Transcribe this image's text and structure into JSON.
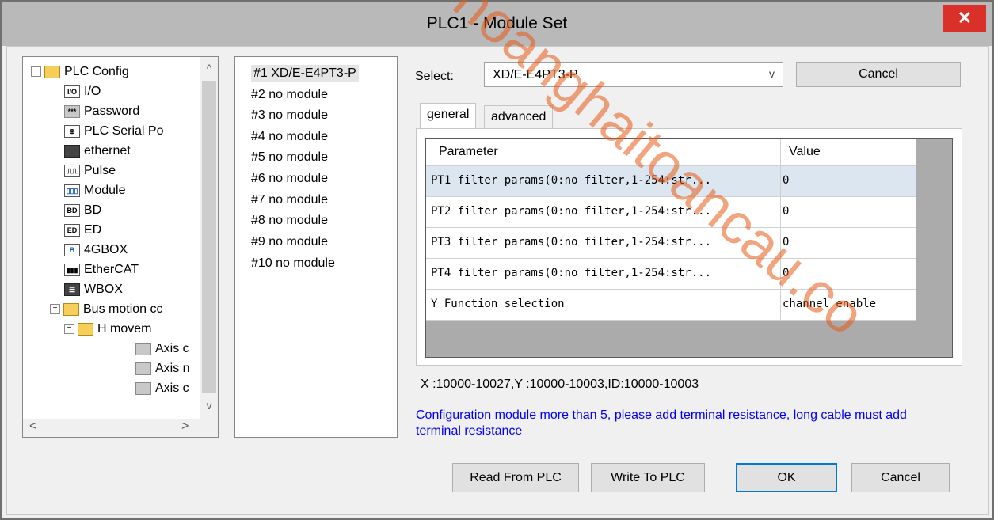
{
  "window": {
    "title": "PLC1 - Module  Set",
    "close_glyph": "✕"
  },
  "tree": {
    "items": [
      {
        "label": "PLC Config",
        "icon": "folder-icon",
        "icon_text": "",
        "expander": "−"
      },
      {
        "label": "I/O",
        "icon": "io-icon",
        "icon_text": "I/O"
      },
      {
        "label": "Password",
        "icon": "password-icon",
        "icon_text": "***"
      },
      {
        "label": "PLC Serial Po",
        "icon": "serial-port-icon",
        "icon_text": "⊕"
      },
      {
        "label": "ethernet",
        "icon": "ethernet-icon",
        "icon_text": ""
      },
      {
        "label": "Pulse",
        "icon": "pulse-icon",
        "icon_text": "⎍⎍"
      },
      {
        "label": "Module",
        "icon": "module-icon",
        "icon_text": "▯▯▯"
      },
      {
        "label": "BD",
        "icon": "bd-icon",
        "icon_text": "BD"
      },
      {
        "label": "ED",
        "icon": "ed-icon",
        "icon_text": "ED"
      },
      {
        "label": "4GBOX",
        "icon": "4gbox-icon",
        "icon_text": "B"
      },
      {
        "label": "EtherCAT",
        "icon": "ethercat-icon",
        "icon_text": "▮▮▮"
      },
      {
        "label": "WBOX",
        "icon": "wbox-icon",
        "icon_text": "☰"
      },
      {
        "label": "Bus motion cc",
        "icon": "folder-icon",
        "icon_text": "",
        "expander": "−"
      },
      {
        "label": "H movem",
        "icon": "folder-icon",
        "icon_text": "",
        "expander": "−"
      },
      {
        "label": "Axis c",
        "icon": "axis-icon",
        "icon_text": ""
      },
      {
        "label": "Axis n",
        "icon": "axis-icon",
        "icon_text": ""
      },
      {
        "label": "Axis c",
        "icon": "axis-icon",
        "icon_text": ""
      }
    ],
    "scroll_up": "^",
    "scroll_down": "v",
    "scroll_left": "<",
    "scroll_right": ">"
  },
  "modules": [
    "#1 XD/E-E4PT3-P",
    "#2 no module",
    "#3 no module",
    "#4 no module",
    "#5 no module",
    "#6 no module",
    "#7 no module",
    "#8 no module",
    "#9 no module",
    "#10 no module"
  ],
  "select": {
    "label": "Select:",
    "value": "XD/E-E4PT3-P",
    "chevron": "v"
  },
  "top_cancel_label": "Cancel",
  "tabs": {
    "general": "general",
    "advanced": "advanced"
  },
  "grid": {
    "headers": {
      "parameter": "Parameter",
      "value": "Value"
    },
    "rows": [
      {
        "param": "PT1 filter params(0:no filter,1-254:str...",
        "value": "0"
      },
      {
        "param": "PT2 filter params(0:no filter,1-254:str...",
        "value": "0"
      },
      {
        "param": "PT3 filter params(0:no filter,1-254:str...",
        "value": "0"
      },
      {
        "param": "PT4 filter params(0:no filter,1-254:str...",
        "value": "0"
      },
      {
        "param": "Y Function selection",
        "value": "channel  enable"
      }
    ]
  },
  "address_info": "X :10000-10027,Y :10000-10003,ID:10000-10003",
  "note": "Configuration module more than 5, please add terminal resistance, long cable must add terminal resistance",
  "buttons": {
    "read": "Read From PLC",
    "write": "Write To PLC",
    "ok": "OK",
    "cancel": "Cancel"
  },
  "watermark": "hoanghaitoancau.co",
  "colors": {
    "title_bg": "#b9b9b9",
    "close_bg": "#d9302a",
    "note_text": "#0000ff",
    "grid_bg": "#ababab",
    "selected_row": "#dce6f1"
  }
}
